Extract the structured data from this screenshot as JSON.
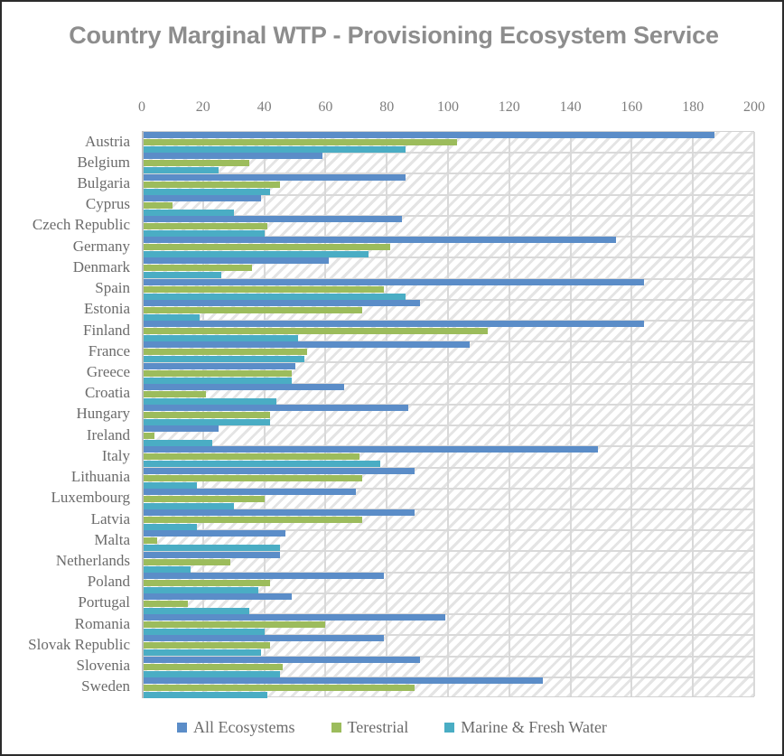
{
  "chart_data": {
    "type": "bar",
    "orientation": "horizontal",
    "title": "Country Marginal WTP - Provisioning Ecosystem Service",
    "xlabel": "",
    "ylabel": "",
    "xlim": [
      0,
      200
    ],
    "xticks": [
      0,
      20,
      40,
      60,
      80,
      100,
      120,
      140,
      160,
      180,
      200
    ],
    "grid": true,
    "legend_position": "bottom",
    "categories": [
      "Austria",
      "Belgium",
      "Bulgaria",
      "Cyprus",
      "Czech Republic",
      "Germany",
      "Denmark",
      "Spain",
      "Estonia",
      "Finland",
      "France",
      "Greece",
      "Croatia",
      "Hungary",
      "Ireland",
      "Italy",
      "Lithuania",
      "Luxembourg",
      "Latvia",
      "Malta",
      "Netherlands",
      "Poland",
      "Portugal",
      "Romania",
      "Slovak Republic",
      "Slovenia",
      "Sweden"
    ],
    "series": [
      {
        "name": "All Ecosystems",
        "color": "#5b8dc8",
        "values": [
          187,
          59,
          86,
          39,
          85,
          155,
          61,
          164,
          91,
          164,
          107,
          50,
          66,
          87,
          25,
          149,
          89,
          70,
          89,
          47,
          45,
          79,
          49,
          99,
          79,
          91,
          131
        ]
      },
      {
        "name": "Terestrial",
        "color": "#9cbc5c",
        "values": [
          103,
          35,
          45,
          10,
          41,
          81,
          36,
          79,
          72,
          113,
          54,
          49,
          21,
          42,
          4,
          71,
          72,
          40,
          72,
          5,
          29,
          42,
          15,
          60,
          42,
          46,
          89
        ]
      },
      {
        "name": "Marine & Fresh Water",
        "color": "#4aadc4",
        "values": [
          86,
          25,
          42,
          30,
          40,
          74,
          26,
          86,
          19,
          51,
          53,
          49,
          44,
          42,
          23,
          78,
          18,
          30,
          18,
          45,
          16,
          38,
          35,
          40,
          39,
          45,
          41
        ]
      }
    ]
  },
  "legend": {
    "items": [
      {
        "label": "All Ecosystems",
        "color": "#5b8dc8"
      },
      {
        "label": "Terestrial",
        "color": "#9cbc5c"
      },
      {
        "label": "Marine & Fresh Water",
        "color": "#4aadc4"
      }
    ]
  }
}
